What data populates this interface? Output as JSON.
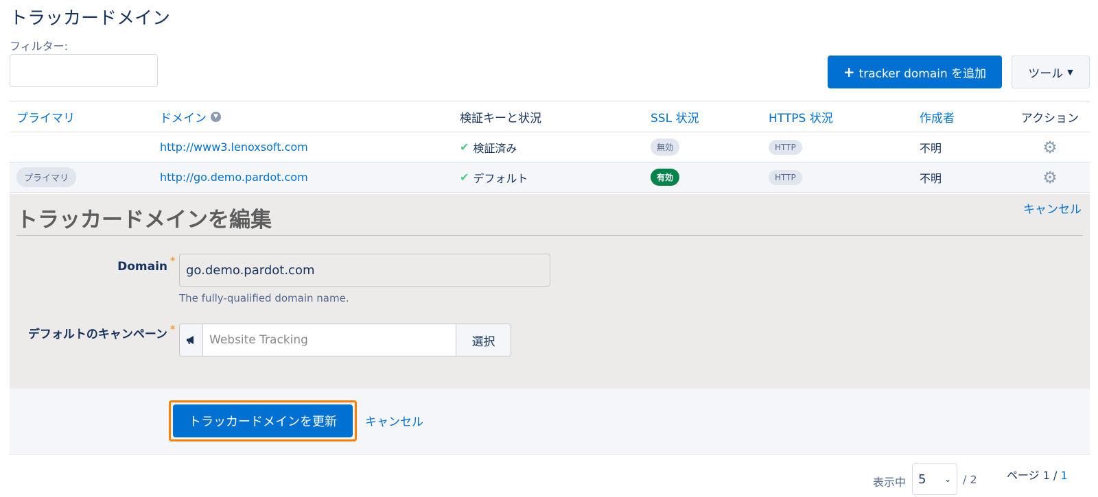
{
  "header": {
    "title": "トラッカードメイン",
    "filter_label": "フィルター:",
    "filter_value": ""
  },
  "toolbar": {
    "add_button_label": "tracker domain を追加",
    "tools_button_label": "ツール"
  },
  "table": {
    "columns": [
      "プライマリ",
      "ドメイン",
      "検証キーと状況",
      "SSL 状況",
      "HTTPS 状況",
      "作成者",
      "アクション"
    ],
    "rows": [
      {
        "primary": "",
        "domain": "http://www3.lenoxsoft.com",
        "verification": "検証済み",
        "ssl": "無効",
        "https": "HTTP",
        "creator": "不明"
      },
      {
        "primary": "プライマリ",
        "domain": "http://go.demo.pardot.com",
        "verification": "デフォルト",
        "ssl": "有効",
        "https": "HTTP",
        "creator": "不明"
      }
    ]
  },
  "edit_form": {
    "title": "トラッカードメインを編集",
    "cancel_label": "キャンセル",
    "domain_label": "Domain",
    "domain_value": "go.demo.pardot.com",
    "domain_help": "The fully-qualified domain name.",
    "campaign_label": "デフォルトのキャンペーン",
    "campaign_placeholder": "Website Tracking",
    "select_label": "選択",
    "submit_label": "トラッカードメインを更新",
    "bottom_cancel_label": "キャンセル"
  },
  "pagination": {
    "showing_label": "表示中",
    "page_size": "5",
    "total": "/ 2",
    "page_label": "ページ 1 /",
    "page_link": "1"
  },
  "colors": {
    "brand_blue": "#0070d2",
    "success_green": "#04844b",
    "highlight_orange": "#ff7f00"
  }
}
